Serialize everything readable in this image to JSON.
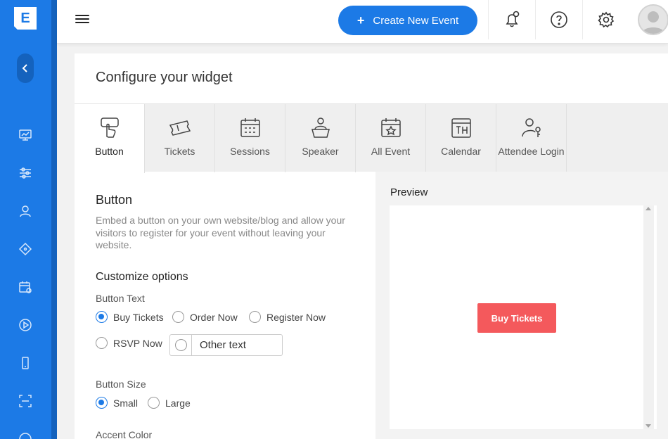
{
  "logo": {
    "letter": "E"
  },
  "topbar": {
    "create_label": "Create New Event",
    "icons": [
      "bell-icon",
      "help-icon",
      "gear-icon",
      "avatar"
    ]
  },
  "sidebar": {
    "icons": [
      "dashboard-icon",
      "sliders-icon",
      "user-icon",
      "ticket-icon",
      "calendar-settings-icon",
      "play-icon",
      "mobile-icon",
      "scan-icon",
      "chat-icon"
    ]
  },
  "card": {
    "title": "Configure your widget",
    "tabs": [
      {
        "label": "Button",
        "icon": "button-click-icon",
        "active": true
      },
      {
        "label": "Tickets",
        "icon": "tickets-icon"
      },
      {
        "label": "Sessions",
        "icon": "sessions-calendar-icon"
      },
      {
        "label": "Speaker",
        "icon": "speaker-icon"
      },
      {
        "label": "All Event",
        "icon": "all-event-icon"
      },
      {
        "label": "Calendar",
        "icon": "calendar-th-icon"
      },
      {
        "label": "Attendee Login",
        "icon": "attendee-login-icon"
      }
    ]
  },
  "button_section": {
    "heading": "Button",
    "description": "Embed a button on your own website/blog and allow your visitors to register for your event without leaving your website.",
    "customize_heading": "Customize options",
    "button_text_label": "Button Text",
    "text_options": [
      "Buy Tickets",
      "Order Now",
      "Register Now",
      "RSVP Now"
    ],
    "text_selected": "Buy Tickets",
    "other_text_placeholder": "Other text",
    "button_size_label": "Button Size",
    "size_options": [
      "Small",
      "Large"
    ],
    "size_selected": "Small",
    "accent_color_label": "Accent Color"
  },
  "preview": {
    "title": "Preview",
    "button_label": "Buy Tickets",
    "button_color": "#f4595c"
  },
  "colors": {
    "brand": "#1c7ae6",
    "sidebar_dark": "#1462bd"
  }
}
